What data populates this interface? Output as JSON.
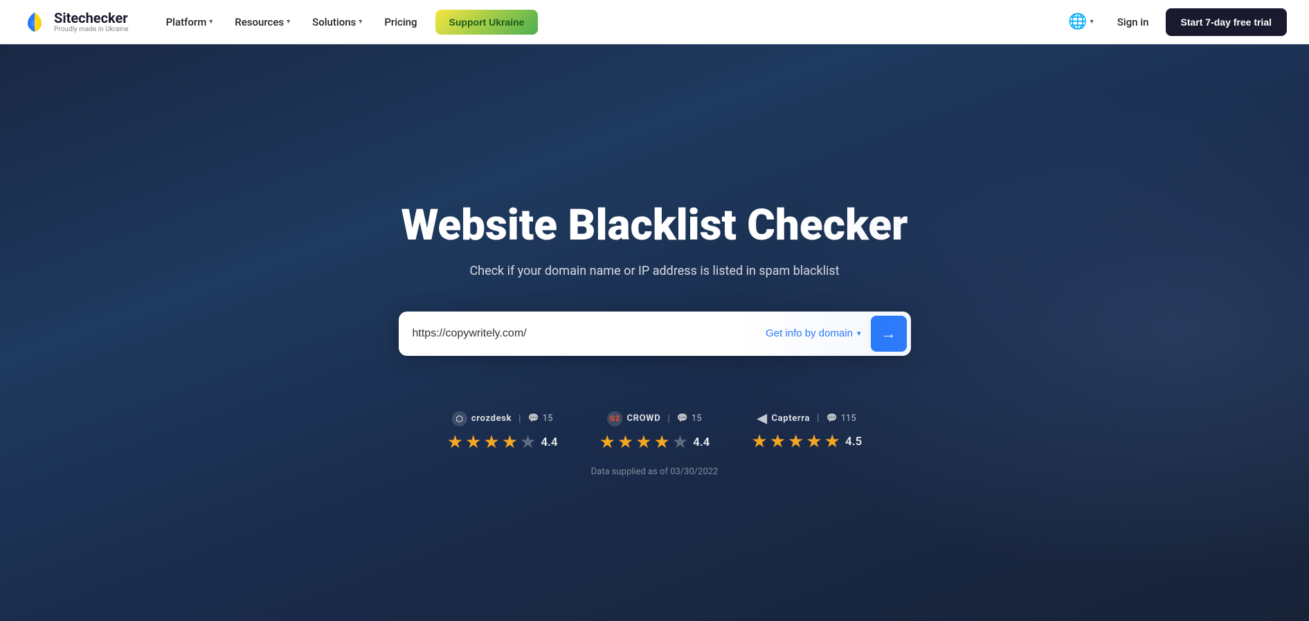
{
  "navbar": {
    "logo_name": "Sitechecker",
    "logo_tagline": "Proudly made in Ukraine",
    "nav_items": [
      {
        "label": "Platform",
        "has_dropdown": true
      },
      {
        "label": "Resources",
        "has_dropdown": true
      },
      {
        "label": "Solutions",
        "has_dropdown": true
      },
      {
        "label": "Pricing",
        "has_dropdown": false
      }
    ],
    "support_btn": "Support Ukraine",
    "sign_in": "Sign in",
    "trial_btn": "Start 7-day free trial"
  },
  "hero": {
    "title": "Website Blacklist Checker",
    "subtitle": "Check if your domain name or IP address is listed in spam blacklist",
    "search_placeholder": "https://copywritely.com/",
    "get_info_label": "Get info by domain",
    "search_btn_label": "→"
  },
  "ratings": [
    {
      "platform": "crozdesk",
      "platform_display": "crozdesk",
      "reviews_count": "15",
      "score": "4.4",
      "full_stars": 3,
      "half_star": true,
      "empty_stars": 1
    },
    {
      "platform": "g2crowd",
      "platform_display": "CROWD",
      "reviews_count": "15",
      "score": "4.4",
      "full_stars": 3,
      "half_star": true,
      "empty_stars": 1
    },
    {
      "platform": "capterra",
      "platform_display": "Capterra",
      "reviews_count": "115",
      "score": "4.5",
      "full_stars": 4,
      "half_star": true,
      "empty_stars": 0
    }
  ],
  "data_note": "Data supplied as of 03/30/2022"
}
